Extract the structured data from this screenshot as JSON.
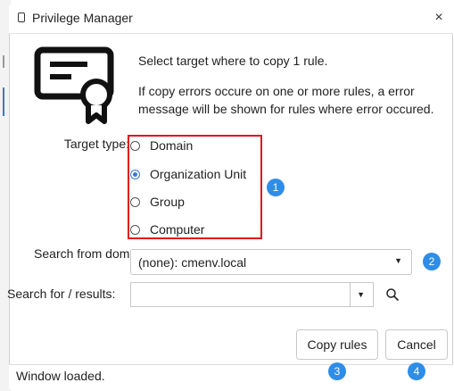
{
  "window": {
    "title": "Privilege Manager",
    "close_label": "×",
    "icon": "document-icon"
  },
  "illustration": {
    "icon": "certificate-icon"
  },
  "message": {
    "line1": "Select target where to copy 1 rule.",
    "line2": "If copy errors occure on one or more rules, a error message will be shown for rules where error occured."
  },
  "target_type": {
    "label": "Target type:",
    "options": [
      {
        "label": "Domain",
        "selected": false
      },
      {
        "label": "Organization Unit",
        "selected": true
      },
      {
        "label": "Group",
        "selected": false
      },
      {
        "label": "Computer",
        "selected": false
      }
    ]
  },
  "search_from": {
    "label": "Search from domain:",
    "value": "(none): cmenv.local"
  },
  "search_for": {
    "label": "Search for / results:",
    "value": ""
  },
  "buttons": {
    "copy_rules": "Copy rules",
    "cancel": "Cancel"
  },
  "annotations": [
    "1",
    "2",
    "3",
    "4"
  ],
  "status": "Window loaded.",
  "colors": {
    "highlight_border": "#e0141e",
    "badge": "#2f8de8",
    "radio_selected": "#3a7ad6"
  }
}
